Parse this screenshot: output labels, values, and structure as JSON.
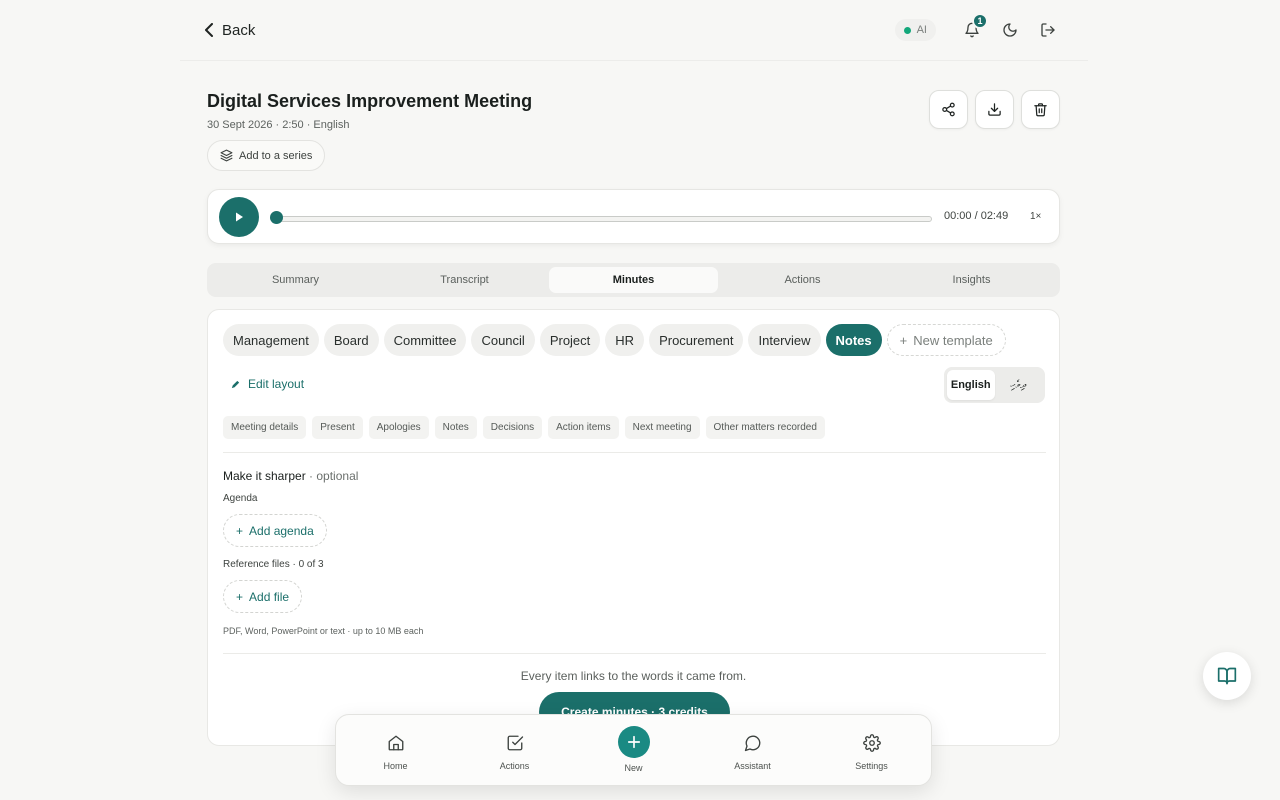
{
  "header": {
    "back_label": "Back",
    "ai_label": "AI",
    "notification_count": "1",
    "icons": [
      "bell-icon",
      "moon-icon",
      "logout-icon"
    ]
  },
  "meeting": {
    "title": "Digital Services Improvement Meeting",
    "meta": "30 Sept 2026 · 2:50 · English",
    "series_label": "Add to a series",
    "actions": [
      "share-icon",
      "download-icon",
      "trash-icon"
    ]
  },
  "player": {
    "time": "00:00 / 02:49",
    "speed": "1×",
    "progress": 0
  },
  "tabs": {
    "items": [
      "Summary",
      "Transcript",
      "Minutes",
      "Actions",
      "Insights"
    ],
    "active": "Minutes"
  },
  "templates": {
    "items": [
      "Management",
      "Board",
      "Committee",
      "Council",
      "Project",
      "HR",
      "Procurement",
      "Interview",
      "Notes"
    ],
    "active": "Notes",
    "new_label": "New template"
  },
  "layout": {
    "edit_label": "Edit layout",
    "languages": [
      "English",
      "ދިވެހި"
    ],
    "active_language": "English"
  },
  "sections": [
    "Meeting details",
    "Present",
    "Apologies",
    "Notes",
    "Decisions",
    "Action items",
    "Next meeting",
    "Other matters recorded"
  ],
  "sharper": {
    "title": "Make it sharper",
    "optional": " · optional",
    "agenda_label": "Agenda",
    "add_agenda": "Add agenda",
    "ref_label": "Reference files · 0 of 3",
    "add_file": "Add file",
    "hint": "PDF, Word, PowerPoint or text · up to 10 MB each"
  },
  "footer": {
    "text": "Every item links to the words it came from.",
    "create_label": "Create minutes · 3 credits"
  },
  "nav": {
    "home": "Home",
    "actions": "Actions",
    "new": "New",
    "assistant": "Assistant",
    "settings": "Settings"
  },
  "colors": {
    "accent": "#1b6f6a",
    "status_green": "#12a77a",
    "background": "#f7f7f5"
  }
}
